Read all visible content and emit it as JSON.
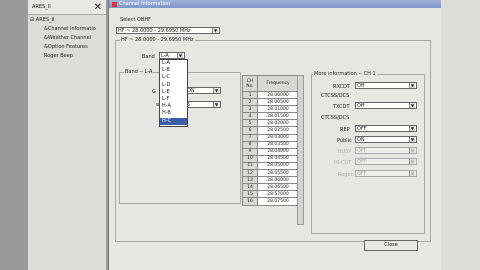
{
  "left": {
    "title": "ARES_II",
    "root": "ARES_II",
    "items": [
      {
        "label": "&Channel Informatio"
      },
      {
        "label": "&Weather Channel"
      },
      {
        "label": "&Option Features"
      },
      {
        "label": "Roger Beep"
      }
    ]
  },
  "window": {
    "title": "Channel Information"
  },
  "select_obhf": {
    "label": "Select OBHF",
    "value": "HF ~ 28.0000 - 29.6950 MHz",
    "group_title": "HF ~ 28.0000 - 29.6950 MHz"
  },
  "band": {
    "label": "Band",
    "value": "L-A",
    "group_title": "Band -- L-A",
    "options": [
      "L-A",
      "L-B",
      "L-C",
      "L-D",
      "L-E",
      "L-F",
      "H-A",
      "H-B",
      "H-C"
    ],
    "selected_index": 8
  },
  "partial": {
    "label1": "G",
    "label2": "w",
    "combo1": "ON",
    "combo2": "5"
  },
  "channels": {
    "col_no": "CH No.",
    "col_freq": "Frequency",
    "rows": [
      {
        "no": "1",
        "freq": "28.00000"
      },
      {
        "no": "2",
        "freq": "28.00500"
      },
      {
        "no": "3",
        "freq": "28.01000"
      },
      {
        "no": "4",
        "freq": "28.01500"
      },
      {
        "no": "5",
        "freq": "28.02000"
      },
      {
        "no": "6",
        "freq": "28.02500"
      },
      {
        "no": "7",
        "freq": "28.03000"
      },
      {
        "no": "8",
        "freq": "28.03500"
      },
      {
        "no": "9",
        "freq": "28.04000"
      },
      {
        "no": "10",
        "freq": "28.04500"
      },
      {
        "no": "11",
        "freq": "28.05000"
      },
      {
        "no": "12",
        "freq": "28.05500"
      },
      {
        "no": "13",
        "freq": "28.06000"
      },
      {
        "no": "14",
        "freq": "28.06500"
      },
      {
        "no": "15",
        "freq": "28.57000"
      },
      {
        "no": "16",
        "freq": "28.07500"
      }
    ]
  },
  "more_info": {
    "title": "More information -- CH 1",
    "rxctdt": {
      "label": "RXCDT",
      "value": "Off"
    },
    "ctcss1": "CTCSS/DCS",
    "txcdt": {
      "label": "TXCDT",
      "value": "Off"
    },
    "ctcss2": "CTCSS/DCS",
    "rep": {
      "label": "REP",
      "value": "OFF"
    },
    "public": {
      "label": "Public",
      "value": "ON"
    },
    "busy": {
      "label": "BUSY",
      "value": "OFF"
    },
    "hicut": {
      "label": "HI-CUT",
      "value": "OFF"
    },
    "roger": {
      "label": "Roger",
      "value": "OFF"
    }
  },
  "close_label": "Close"
}
